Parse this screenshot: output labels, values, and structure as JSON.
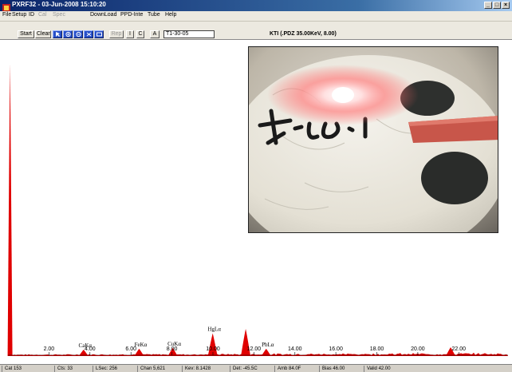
{
  "window": {
    "title": "PXRF32 - 03-Jun-2008 15:10:20",
    "controls": [
      "_",
      "□",
      "×"
    ]
  },
  "menu": [
    {
      "label": "File",
      "enabled": true
    },
    {
      "label": "Setup",
      "enabled": true
    },
    {
      "label": "ID",
      "enabled": true
    },
    {
      "label": "Cal",
      "enabled": false
    },
    {
      "label": "Spec",
      "enabled": false
    },
    {
      "label": "DownLoad",
      "enabled": true
    },
    {
      "label": "PPD-Inte",
      "enabled": true
    },
    {
      "label": "Tube",
      "enabled": true
    },
    {
      "label": "Help",
      "enabled": true
    }
  ],
  "toolbar": {
    "start_label": "Start",
    "clear_label": "Clear",
    "rep_label": "Rep",
    "i_label": "I",
    "c_label": "C",
    "a_label": "A",
    "sample_id": "T1-30-05",
    "setting": "KTI  (.PDZ 35.00KeV, 8.00)"
  },
  "statusbar": [
    {
      "label": "Cat 153"
    },
    {
      "label": "Cts: 33"
    },
    {
      "label": "LSec: 256"
    },
    {
      "label": "Chan 5,621"
    },
    {
      "label": "Kev: 8.1428"
    },
    {
      "label": "Det: -45.5C"
    },
    {
      "label": "Amb 84.0F"
    },
    {
      "label": "Bias 46.00"
    },
    {
      "label": "Valid 42.00"
    }
  ],
  "chart_data": {
    "type": "line",
    "xlabel": "",
    "ylabel": "",
    "xlim": [
      0,
      24.4
    ],
    "ylim": [
      0,
      100
    ],
    "x_ticks": [
      2,
      4,
      6,
      8,
      10,
      12,
      14,
      16,
      18,
      20,
      22
    ],
    "tick_labels": [
      "2.00",
      "4.00",
      "6.00",
      "8.00",
      "10.00",
      "12.00",
      "14.00",
      "16.00",
      "18.00",
      "20.00",
      "22.00"
    ],
    "color": "#e00000",
    "peaks": [
      {
        "keV": 0.1,
        "height": 100,
        "label": ""
      },
      {
        "keV": 3.69,
        "height": 2.2,
        "label": "CaKα"
      },
      {
        "keV": 6.4,
        "height": 2.5,
        "label": "FeKα"
      },
      {
        "keV": 8.04,
        "height": 2.8,
        "label": "CuKα"
      },
      {
        "keV": 9.99,
        "height": 7.8,
        "label": "HgLα"
      },
      {
        "keV": 11.6,
        "height": 9.3,
        "label": ""
      },
      {
        "keV": 12.6,
        "height": 2.5,
        "label": "PbLα"
      },
      {
        "keV": 21.6,
        "height": 3.0,
        "label": ""
      }
    ]
  },
  "photo": {
    "handwriting": "4-10-1"
  }
}
